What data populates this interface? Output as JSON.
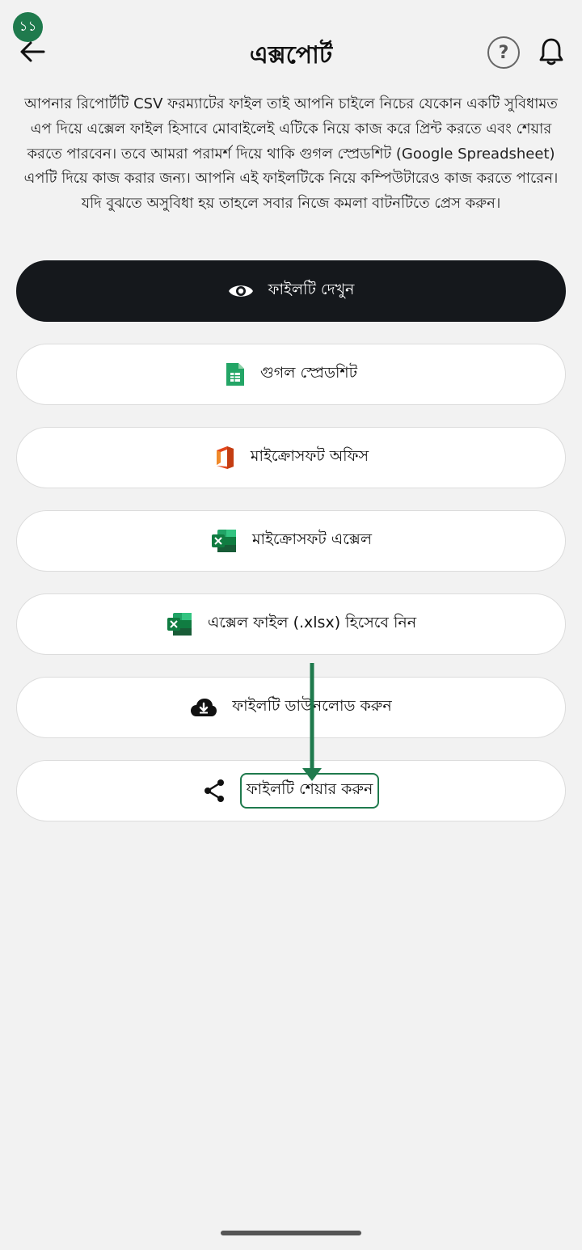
{
  "step_badge": "১১",
  "header": {
    "title": "এক্সপোর্ট",
    "help_label": "?"
  },
  "description": "আপনার রিপোর্টটি CSV ফরম্যাটের ফাইল তাই আপনি চাইলে নিচের যেকোন একটি সুবিধামত এপ দিয়ে এক্সেল ফাইল হিসাবে মোবাইলেই এটিকে নিয়ে কাজ করে প্রিন্ট করতে এবং শেয়ার করতে পারবেন। তবে আমরা পরামর্শ দিয়ে থাকি গুগল স্প্রেডশিট (Google Spreadsheet) এপটি দিয়ে কাজ করার জন্য। আপনি এই ফাইলটিকে নিয়ে কম্পিউটারেও কাজ করতে পারেন। যদি বুঝতে অসুবিধা হয় তাহলে সবার নিজে কমলা বাটনটিতে প্রেস করুন।",
  "buttons": [
    {
      "label": "ফাইলটি দেখুন",
      "icon": "eye-icon"
    },
    {
      "label": "গুগল স্প্রেডশিট",
      "icon": "google-sheets-icon"
    },
    {
      "label": "মাইক্রোসফট অফিস",
      "icon": "microsoft-office-icon"
    },
    {
      "label": "মাইক্রোসফট এক্সেল",
      "icon": "microsoft-excel-icon"
    },
    {
      "label": "এক্সেল ফাইল (.xlsx) হিসেবে নিন",
      "icon": "excel-file-icon"
    },
    {
      "label": "ফাইলটি ডাউনলোড করুন",
      "icon": "cloud-download-icon"
    },
    {
      "label": "ফাইলটি শেয়ার করুন",
      "icon": "share-icon"
    }
  ],
  "colors": {
    "accent": "#1f7a4d",
    "primary_button": "#15181c",
    "background": "#f2f2f2"
  }
}
